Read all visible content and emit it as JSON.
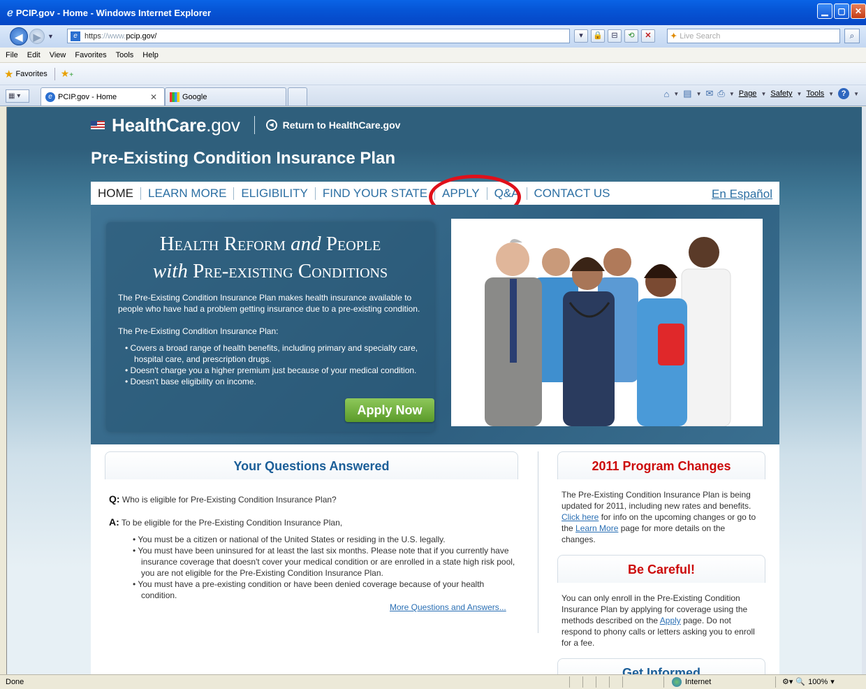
{
  "window": {
    "title": "PCIP.gov - Home - Windows Internet Explorer",
    "url_scheme": "https",
    "url_sep": "://",
    "url_www": "www.",
    "url_domain": "pcip.gov/",
    "search_placeholder": "Live Search"
  },
  "menu": [
    "File",
    "Edit",
    "View",
    "Favorites",
    "Tools",
    "Help"
  ],
  "favorites_label": "Favorites",
  "tabs": [
    {
      "label": "PCIP.gov - Home",
      "active": true
    },
    {
      "label": "Google",
      "active": false
    }
  ],
  "command_bar": {
    "page": "Page",
    "safety": "Safety",
    "tools": "Tools"
  },
  "site": {
    "logo_main": "HealthCare",
    "logo_suffix": ".gov",
    "return_link": "Return to HealthCare.gov",
    "title": "Pre-Existing Condition Insurance Plan",
    "nav": [
      "HOME",
      "LEARN MORE",
      "ELIGIBILITY",
      "FIND YOUR STATE",
      "APPLY",
      "Q&A",
      "CONTACT US"
    ],
    "espanol": "En Español"
  },
  "hero": {
    "heading_line1_a": "Health Reform",
    "heading_line1_b": "and",
    "heading_line1_c": "People",
    "heading_line2_a": "with",
    "heading_line2_b": "Pre-existing Conditions",
    "intro": "The Pre-Existing Condition Insurance Plan makes health insurance available to people who have had a problem getting insurance due to a pre-existing condition.",
    "list_intro": "The Pre-Existing Condition Insurance Plan:",
    "bullets": [
      "Covers a broad range of health benefits, including primary and specialty care, hospital care, and prescription drugs.",
      "Doesn't charge you a higher premium just because of your medical condition.",
      "Doesn't base eligibility on income."
    ],
    "apply_button": "Apply Now"
  },
  "questions": {
    "heading": "Your Questions Answered",
    "q_label": "Q:",
    "question": "Who is eligible for Pre-Existing Condition Insurance Plan?",
    "a_label": "A:",
    "answer_intro": "To be eligible for the Pre-Existing Condition Insurance Plan,",
    "answer_bullets": [
      "You must be a citizen or national of the United States or residing in the U.S. legally.",
      "You must have been uninsured for at least the last six months. Please note that if you currently have insurance coverage that doesn't cover your medical condition or are enrolled in a state high risk pool, you are not eligible for the Pre-Existing Condition Insurance Plan.",
      "You must have a pre-existing condition or have been denied coverage because of your health condition."
    ],
    "more_link": "More Questions and Answers..."
  },
  "sidebar": {
    "changes_heading": "2011 Program Changes",
    "changes_text_1": "The Pre-Existing Condition Insurance Plan is being updated for 2011, including new rates and benefits.",
    "changes_link_1": "Click here",
    "changes_text_2": "for info on the upcoming changes or go to the",
    "changes_link_2": "Learn More",
    "changes_text_3": "page for more details on the changes.",
    "careful_heading": "Be Careful!",
    "careful_text_1": "You can only enroll in the Pre-Existing Condition Insurance Plan by applying for coverage using the methods described on the",
    "careful_link": "Apply",
    "careful_text_2": "page. Do not respond to phony calls or letters asking you to enroll for a fee.",
    "informed_heading": "Get Informed"
  },
  "status": {
    "text": "Done",
    "zone": "Internet",
    "zoom": "100%"
  },
  "colors": {
    "brand_blue": "#2c6fa3",
    "highlight_red": "#e0101a",
    "apply_green": "#6aaa35",
    "alert_red": "#cc0a0a"
  }
}
